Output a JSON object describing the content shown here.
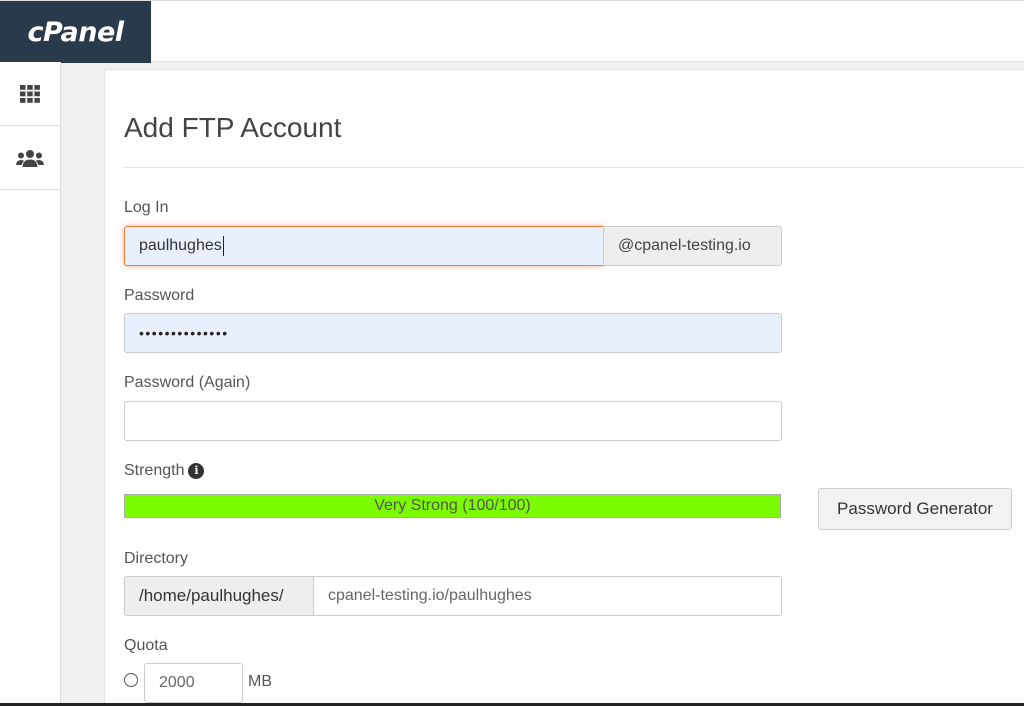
{
  "brand": {
    "logo_text": "cPanel"
  },
  "sidebar": {
    "items": [
      {
        "icon": "grid-icon"
      },
      {
        "icon": "users-icon"
      }
    ]
  },
  "page": {
    "title": "Add FTP Account",
    "login_label": "Log In",
    "login_value": "paulhughes",
    "domain_suffix": "@cpanel-testing.io",
    "password_label": "Password",
    "password_dots": "••••••••••••••",
    "password_again_label": "Password (Again)",
    "password_again_value": "",
    "strength_label": "Strength",
    "strength_info_icon": "info-icon",
    "strength_text": "Very Strong (100/100)",
    "strength_value": 100,
    "strength_max": 100,
    "strength_color": "#7cfc00",
    "generator_button": "Password Generator",
    "directory_label": "Directory",
    "directory_prefix": "/home/paulhughes/",
    "directory_value": "cpanel-testing.io/paulhughes",
    "quota_label": "Quota",
    "quota_value": "2000",
    "quota_unit": "MB"
  }
}
